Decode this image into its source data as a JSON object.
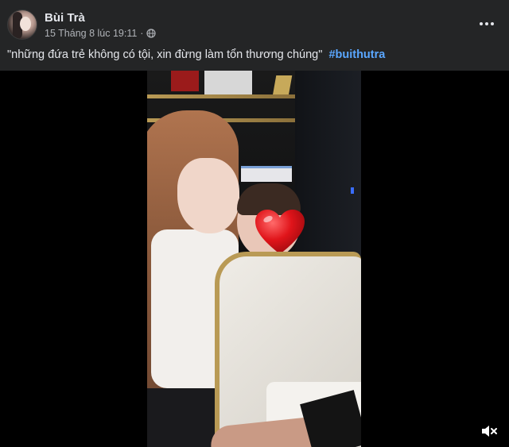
{
  "post": {
    "author_name": "Bùi Trà",
    "timestamp": "15 Tháng 8 lúc 19:11",
    "separator": "·",
    "caption": "\"những đứa trẻ không có tội, xin đừng làm tổn thương chúng\"",
    "hashtag": "#buithutra",
    "privacy_icon": "globe-icon",
    "more_icon": "more-options-icon"
  },
  "video": {
    "overlay_icon": "heart-icon",
    "control_icon": "volume-muted-icon"
  },
  "colors": {
    "header_bg": "#242526",
    "link": "#5aa7ff",
    "text_primary": "#e4e6eb",
    "text_secondary": "#b0b3b8",
    "heart": "#e0141a"
  }
}
